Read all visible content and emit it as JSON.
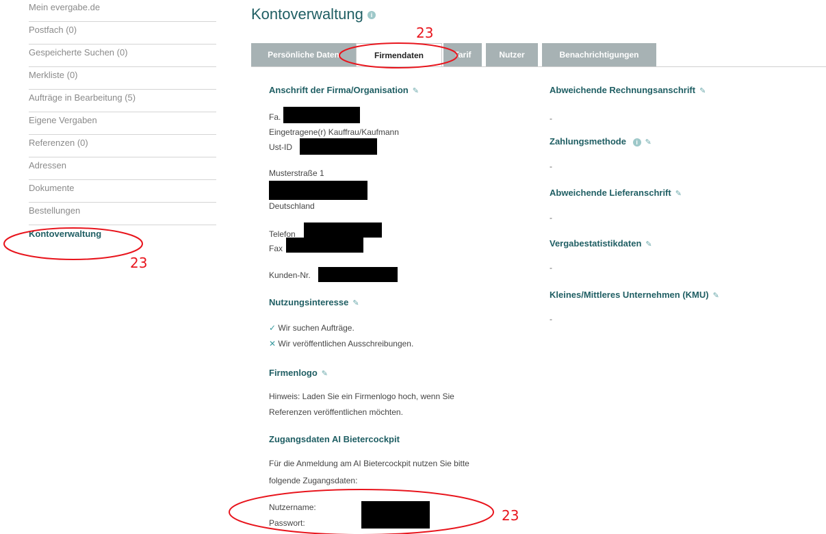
{
  "sidebar": {
    "items": [
      {
        "label": "Mein evergabe.de"
      },
      {
        "label": "Postfach (0)"
      },
      {
        "label": "Gespeicherte Suchen (0)"
      },
      {
        "label": "Merkliste (0)"
      },
      {
        "label": "Aufträge in Bearbeitung (5)"
      },
      {
        "label": "Eigene Vergaben"
      },
      {
        "label": "Referenzen (0)"
      },
      {
        "label": "Adressen"
      },
      {
        "label": "Dokumente"
      },
      {
        "label": "Bestellungen"
      },
      {
        "label": "Kontoverwaltung"
      }
    ]
  },
  "page_title": "Kontoverwaltung",
  "tabs": [
    {
      "label": "Persönliche Daten"
    },
    {
      "label": "Firmendaten"
    },
    {
      "label": "Tarif"
    },
    {
      "label": "Nutzer"
    },
    {
      "label": "Benachrichtigungen"
    }
  ],
  "left": {
    "address_heading": "Anschrift der Firma/Organisation",
    "fa_prefix": "Fa.",
    "company_type": "Eingetragene(r) Kauffrau/Kaufmann",
    "ust_label": "Ust-ID",
    "street": "Musterstraße 1",
    "country": "Deutschland",
    "phone_label": "Telefon",
    "fax_label": "Fax",
    "customer_label": "Kunden-Nr.",
    "interest_heading": "Nutzungsinteresse",
    "interest_yes": "Wir suchen Aufträge.",
    "interest_no": "Wir veröffentlichen Ausschreibungen.",
    "logo_heading": "Firmenlogo",
    "logo_hint_1": "Hinweis: Laden Sie ein Firmenlogo hoch, wenn Sie",
    "logo_hint_2": "Referenzen veröffentlichen möchten.",
    "access_heading": "Zugangsdaten AI Bietercockpit",
    "access_text_1": "Für die Anmeldung am AI Bietercockpit nutzen Sie bitte",
    "access_text_2": "folgende Zugangsdaten:",
    "username_label": "Nutzername:",
    "password_label": "Passwort:"
  },
  "right": {
    "billing_heading": "Abweichende Rechnungsanschrift",
    "billing_value": "-",
    "payment_heading": "Zahlungsmethode",
    "payment_value": "-",
    "delivery_heading": "Abweichende Lieferanschrift",
    "delivery_value": "-",
    "stats_heading": "Vergabestatistikdaten",
    "stats_value": "-",
    "kmu_heading": "Kleines/Mittleres Unternehmen (KMU)",
    "kmu_value": "-"
  },
  "annotations": {
    "tab_number": "23",
    "sidebar_number": "23",
    "credentials_number": "23"
  }
}
